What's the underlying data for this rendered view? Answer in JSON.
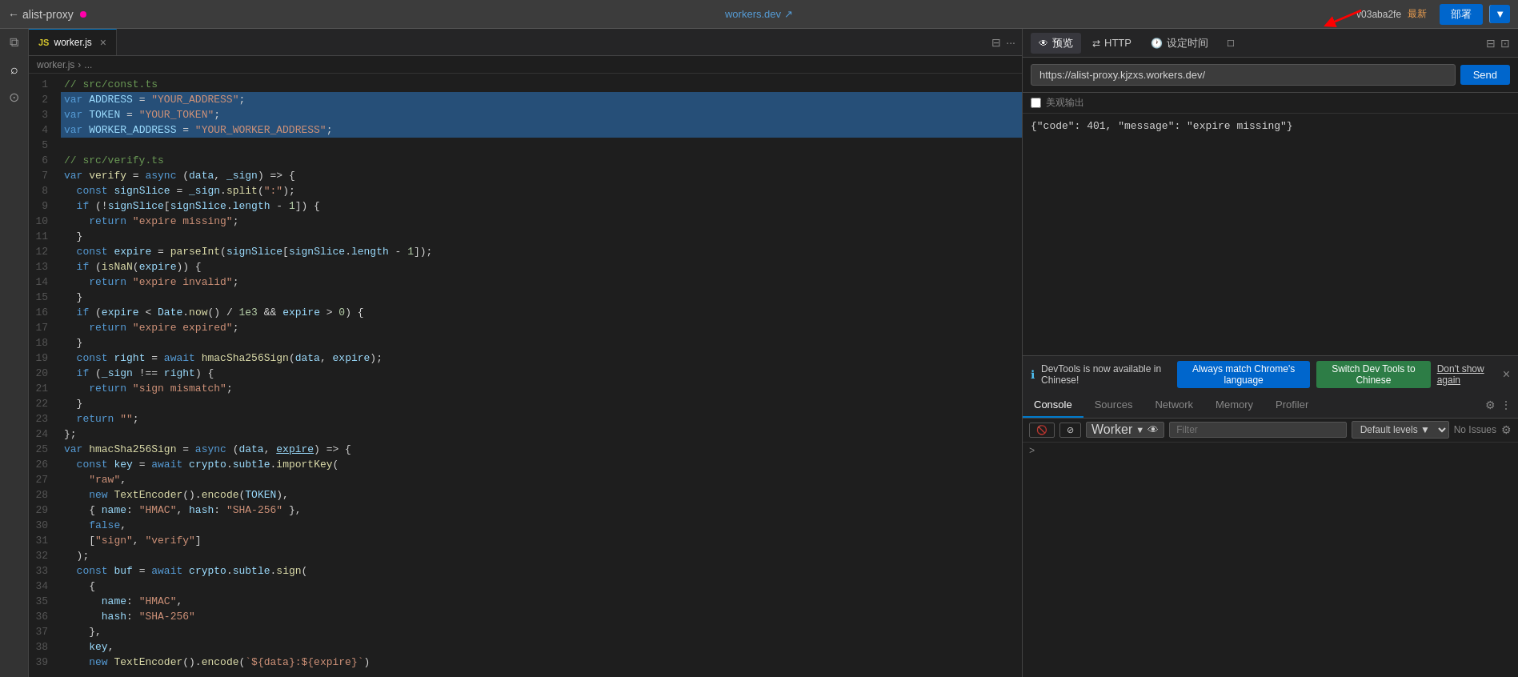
{
  "topbar": {
    "back_label": "alist-proxy",
    "dot_active": true,
    "workers_link": "workers.dev",
    "version": "v03aba2fe",
    "version_tag": "最新",
    "deploy_btn": "部署",
    "external_icon": "↗"
  },
  "tabs": [
    {
      "label": "worker.js",
      "icon": "JS",
      "active": true
    }
  ],
  "breadcrumb": {
    "parts": [
      "worker.js",
      "..."
    ]
  },
  "code": {
    "filename_comment": "// src/const.ts",
    "lines": [
      {
        "num": 1,
        "content": "// src/const.ts",
        "type": "comment"
      },
      {
        "num": 2,
        "content": "var ADDRESS = \"YOUR_ADDRESS\";",
        "highlight": true
      },
      {
        "num": 3,
        "content": "var TOKEN = \"YOUR_TOKEN\";",
        "highlight": true
      },
      {
        "num": 4,
        "content": "var WORKER_ADDRESS = \"YOUR_WORKER_ADDRESS\";",
        "highlight": true
      },
      {
        "num": 5,
        "content": ""
      },
      {
        "num": 6,
        "content": "// src/verify.ts",
        "type": "comment"
      },
      {
        "num": 7,
        "content": "var verify = async (data, _sign) => {"
      },
      {
        "num": 8,
        "content": "  const signSlice = _sign.split(\":\");"
      },
      {
        "num": 9,
        "content": "  if (!signSlice[signSlice.length - 1]) {"
      },
      {
        "num": 10,
        "content": "    return \"expire missing\";"
      },
      {
        "num": 11,
        "content": "  }"
      },
      {
        "num": 12,
        "content": "  const expire = parseInt(signSlice[signSlice.length - 1]);"
      },
      {
        "num": 13,
        "content": "  if (isNaN(expire)) {"
      },
      {
        "num": 14,
        "content": "    return \"expire invalid\";"
      },
      {
        "num": 15,
        "content": "  }"
      },
      {
        "num": 16,
        "content": "  if (expire < Date.now() / 1e3 && expire > 0) {"
      },
      {
        "num": 17,
        "content": "    return \"expire expired\";"
      },
      {
        "num": 18,
        "content": "  }"
      },
      {
        "num": 19,
        "content": "  const right = await hmacSha256Sign(data, expire);"
      },
      {
        "num": 20,
        "content": "  if (_sign !== right) {"
      },
      {
        "num": 21,
        "content": "    return \"sign mismatch\";"
      },
      {
        "num": 22,
        "content": "  }"
      },
      {
        "num": 23,
        "content": "  return \"\";"
      },
      {
        "num": 24,
        "content": "};"
      },
      {
        "num": 25,
        "content": "var hmacSha256Sign = async (data, expire) => {"
      },
      {
        "num": 26,
        "content": "  const key = await crypto.subtle.importKey("
      },
      {
        "num": 27,
        "content": "    \"raw\","
      },
      {
        "num": 28,
        "content": "    new TextEncoder().encode(TOKEN),"
      },
      {
        "num": 29,
        "content": "    { name: \"HMAC\", hash: \"SHA-256\" },"
      },
      {
        "num": 30,
        "content": "    false,"
      },
      {
        "num": 31,
        "content": "    [\"sign\", \"verify\"]"
      },
      {
        "num": 32,
        "content": "  );"
      },
      {
        "num": 33,
        "content": "  const buf = await crypto.subtle.sign("
      },
      {
        "num": 34,
        "content": "    {"
      },
      {
        "num": 35,
        "content": "      name: \"HMAC\","
      },
      {
        "num": 36,
        "content": "      hash: \"SHA-256\""
      },
      {
        "num": 37,
        "content": "    },"
      },
      {
        "num": 38,
        "content": "    key,"
      },
      {
        "num": 39,
        "content": "    new TextEncoder().encode(`${data}:${expire}`)"
      }
    ]
  },
  "right_panel": {
    "tabs": [
      {
        "label": "预览",
        "icon": "👁",
        "active": true
      },
      {
        "label": "HTTP",
        "icon": "⇄"
      },
      {
        "label": "设定时间",
        "icon": "🕐"
      },
      {
        "label": "□",
        "icon": ""
      }
    ],
    "url": "https://alist-proxy.kjzxs.workers.dev/",
    "send_btn": "Send",
    "pretty_print_label": "美观输出",
    "response": "{\"code\": 401, \"message\": \"expire missing\"}",
    "notification": {
      "message": "DevTools is now available in Chinese!",
      "btn1": "Always match Chrome's language",
      "btn2": "Switch Dev Tools to Chinese",
      "dismiss": "Don't show again"
    },
    "console_tabs": [
      {
        "label": "Console",
        "active": true
      },
      {
        "label": "Sources"
      },
      {
        "label": "Network"
      },
      {
        "label": "Memory"
      },
      {
        "label": "Profiler"
      }
    ],
    "filter_placeholder": "Filter",
    "worker_label": "Worker",
    "default_levels": "Default levels",
    "no_issues": "No Issues"
  }
}
